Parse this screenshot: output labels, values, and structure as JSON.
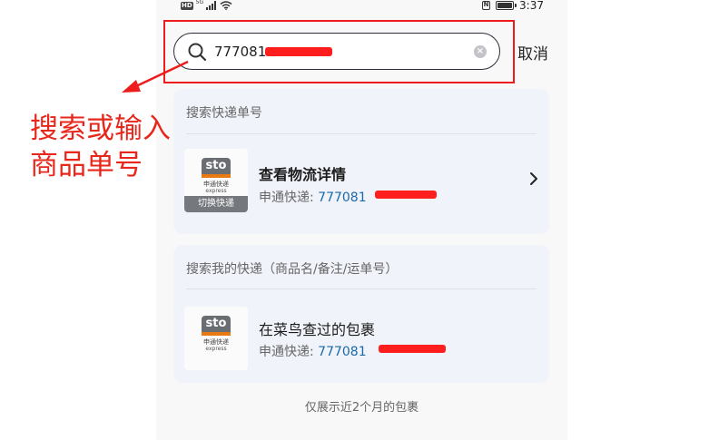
{
  "status_bar": {
    "hd": "HD",
    "net": "5G",
    "time": "3:37",
    "nfc": "N"
  },
  "search": {
    "value": "777081",
    "cancel_label": "取消"
  },
  "express_card": {
    "title": "搜索快递单号",
    "item_title": "查看物流详情",
    "carrier_label": "申通快递:",
    "number": "777081",
    "switch_label": "切换快递"
  },
  "mine_card": {
    "title": "搜索我的快递（商品名/备注/运单号）",
    "item_title": "在菜鸟查过的包裹",
    "carrier_label": "申通快递:",
    "number": "777081"
  },
  "logo": {
    "brand": "sto",
    "brand_sub": "express",
    "name_cn": "申通快递",
    "name_en": "express"
  },
  "footer": {
    "note": "仅展示近2个月的包裹"
  },
  "annotation": {
    "line1": "搜索或输入",
    "line2": "商品单号"
  },
  "colors": {
    "annotation": "#e8271c",
    "link_number": "#1a6aa8",
    "card_bg": "#f1f3fa",
    "sto_orange": "#e87a14"
  }
}
